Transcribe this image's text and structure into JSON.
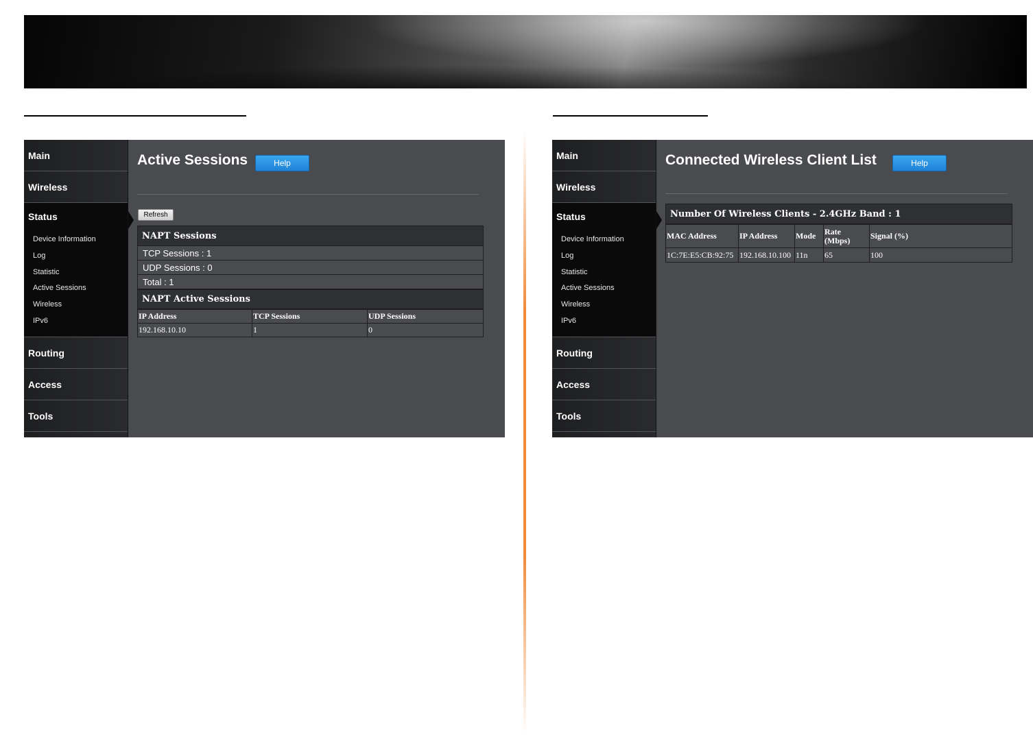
{
  "nav": {
    "main": "Main",
    "wireless": "Wireless",
    "status": "Status",
    "sub": [
      "Device Information",
      "Log",
      "Statistic",
      "Active Sessions",
      "Wireless",
      "IPv6"
    ],
    "routing": "Routing",
    "access": "Access",
    "tools": "Tools"
  },
  "left": {
    "title": "Active Sessions",
    "help": "Help",
    "refresh": "Refresh",
    "napt_sessions": "NAPT Sessions",
    "tcp": "TCP Sessions : 1",
    "udp": "UDP Sessions : 0",
    "total": "Total : 1",
    "napt_active": "NAPT Active Sessions",
    "columns": [
      "IP Address",
      "TCP Sessions",
      "UDP Sessions"
    ],
    "rows": [
      [
        "192.168.10.10",
        "1",
        "0"
      ]
    ]
  },
  "right": {
    "title": "Connected Wireless Client List",
    "help": "Help",
    "band_header": "Number Of Wireless Clients - 2.4GHz Band : 1",
    "columns": [
      "MAC Address",
      "IP Address",
      "Mode",
      "Rate\n(Mbps)",
      "Signal (%)"
    ],
    "rows": [
      [
        "1C:7E:E5:CB:92:75",
        "192.168.10.100",
        "11n",
        "65",
        "100"
      ]
    ]
  },
  "colors": {
    "help_button": "#1f82d6",
    "divider": "#f08a3a",
    "panel_bg": "#4a4b4f"
  }
}
